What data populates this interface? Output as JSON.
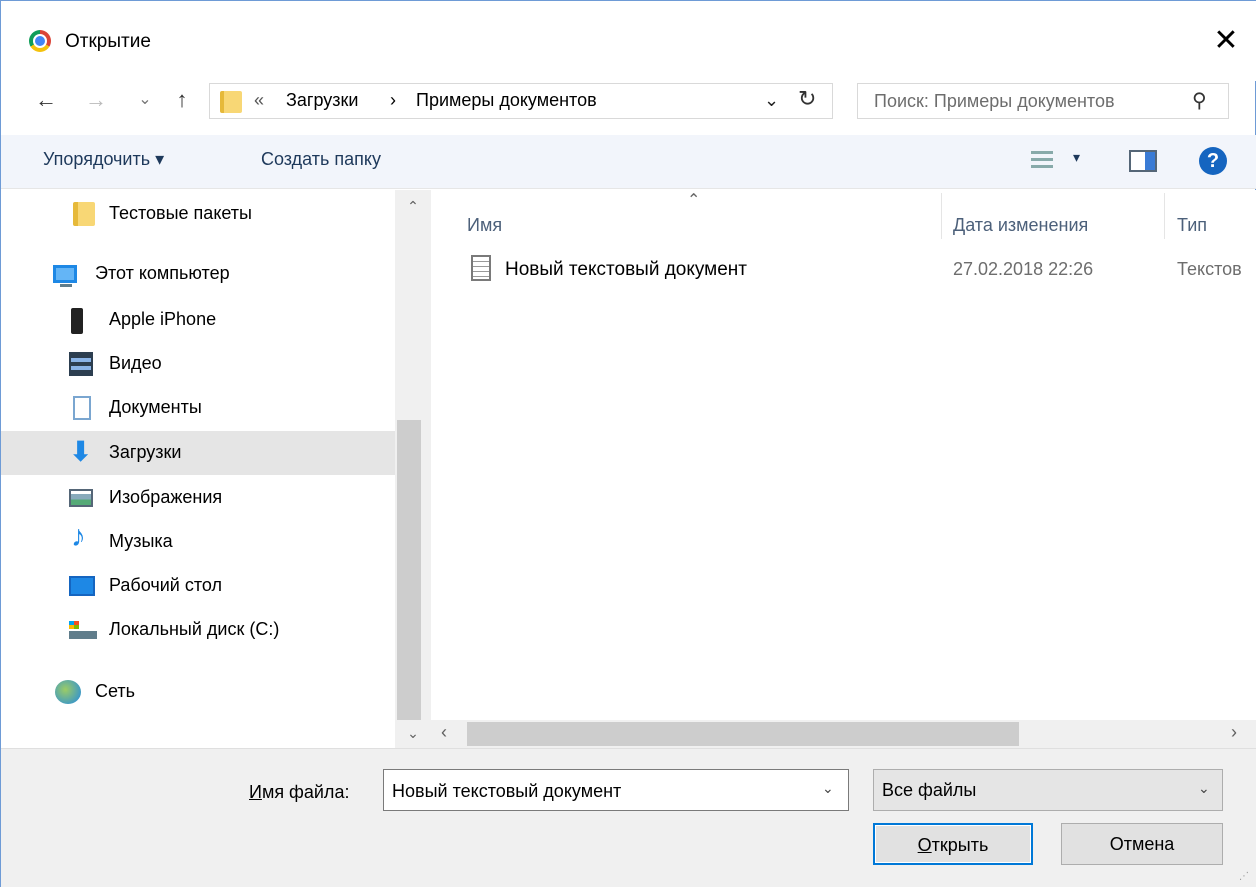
{
  "window": {
    "title": "Открытие",
    "close_label": "✕"
  },
  "nav": {
    "back": "←",
    "forward": "→",
    "recent": "⌄",
    "up": "↑"
  },
  "address": {
    "overflow": "«",
    "crumbs": [
      "Загрузки",
      "Примеры документов"
    ],
    "separator": "›"
  },
  "search": {
    "placeholder": "Поиск: Примеры документов"
  },
  "toolbar": {
    "organize": "Упорядочить ▾",
    "new_folder": "Создать папку",
    "view_dropdown": "▾",
    "help": "?"
  },
  "sidebar": {
    "items": [
      {
        "label": "Тестовые пакеты",
        "icon": "folder-icon"
      },
      {
        "label": "Этот компьютер",
        "icon": "computer-icon"
      },
      {
        "label": "Apple iPhone",
        "icon": "phone-icon"
      },
      {
        "label": "Видео",
        "icon": "video-icon"
      },
      {
        "label": "Документы",
        "icon": "documents-icon"
      },
      {
        "label": "Загрузки",
        "icon": "downloads-icon",
        "selected": true
      },
      {
        "label": "Изображения",
        "icon": "pictures-icon"
      },
      {
        "label": "Музыка",
        "icon": "music-icon"
      },
      {
        "label": "Рабочий стол",
        "icon": "desktop-icon"
      },
      {
        "label": "Локальный диск (C:)",
        "icon": "disk-icon"
      },
      {
        "label": "Сеть",
        "icon": "network-icon"
      }
    ]
  },
  "columns": {
    "name": "Имя",
    "date": "Дата изменения",
    "type": "Тип"
  },
  "files": [
    {
      "name": "Новый текстовый документ",
      "date": "27.02.2018 22:26",
      "type": "Текстов"
    }
  ],
  "bottom": {
    "filename_label_prefix": "И",
    "filename_label_rest": "мя файла:",
    "filename_value": "Новый текстовый документ",
    "filter_value": "Все файлы",
    "open_prefix": "О",
    "open_rest": "ткрыть",
    "cancel": "Отмена"
  },
  "colors": {
    "accent": "#0078d7",
    "selection": "#e5e5e5",
    "toolbar_bg": "#f2f5fb"
  }
}
